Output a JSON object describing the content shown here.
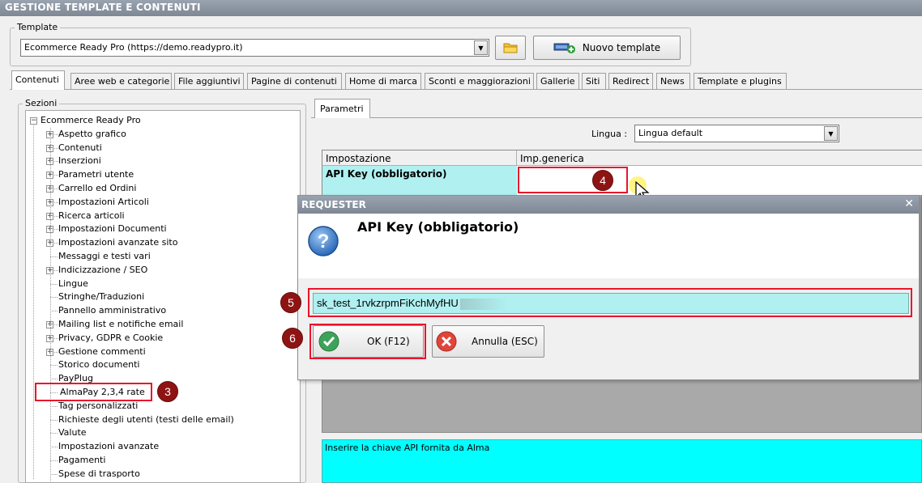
{
  "window": {
    "title": "GESTIONE TEMPLATE E CONTENUTI"
  },
  "template_group": {
    "label": "Template",
    "selected": "Ecommerce Ready Pro (https://demo.readypro.it)",
    "new_button": "Nuovo template"
  },
  "tabs": [
    "Contenuti",
    "Aree web e categorie",
    "File aggiuntivi",
    "Pagine di contenuti",
    "Home di marca",
    "Sconti e maggiorazioni",
    "Gallerie",
    "Siti",
    "Redirect",
    "News",
    "Template e plugins"
  ],
  "tree": {
    "group_label": "Sezioni",
    "root": "Ecommerce Ready Pro",
    "items": [
      {
        "label": "Aspetto grafico",
        "expandable": true
      },
      {
        "label": "Contenuti",
        "expandable": true
      },
      {
        "label": "Inserzioni",
        "expandable": true
      },
      {
        "label": "Parametri utente",
        "expandable": true
      },
      {
        "label": "Carrello ed Ordini",
        "expandable": true
      },
      {
        "label": "Impostazioni Articoli",
        "expandable": true
      },
      {
        "label": "Ricerca articoli",
        "expandable": true
      },
      {
        "label": "Impostazioni Documenti",
        "expandable": true
      },
      {
        "label": "Impostazioni avanzate sito",
        "expandable": true
      },
      {
        "label": "Messaggi e testi vari",
        "expandable": false
      },
      {
        "label": "Indicizzazione / SEO",
        "expandable": true
      },
      {
        "label": "Lingue",
        "expandable": false
      },
      {
        "label": "Stringhe/Traduzioni",
        "expandable": false
      },
      {
        "label": "Pannello amministrativo",
        "expandable": false
      },
      {
        "label": "Mailing list e notifiche email",
        "expandable": true
      },
      {
        "label": "Privacy, GDPR e Cookie",
        "expandable": true
      },
      {
        "label": "Gestione commenti",
        "expandable": true
      },
      {
        "label": "Storico documenti",
        "expandable": false
      },
      {
        "label": "PayPlug",
        "expandable": false
      },
      {
        "label": "AlmaPay 2,3,4 rate",
        "expandable": false,
        "selected": true
      },
      {
        "label": "Tag personalizzati",
        "expandable": false
      },
      {
        "label": "Richieste degli utenti (testi delle email)",
        "expandable": false
      },
      {
        "label": "Valute",
        "expandable": false
      },
      {
        "label": "Impostazioni avanzate",
        "expandable": false
      },
      {
        "label": "Pagamenti",
        "expandable": false
      },
      {
        "label": "Spese di trasporto",
        "expandable": false
      }
    ]
  },
  "params": {
    "tab": "Parametri",
    "language_label": "Lingua :",
    "language_value": "Lingua default",
    "col_setting": "Impostazione",
    "col_generic": "Imp.generica",
    "row_setting": "API Key (obbligatorio)",
    "row_value": "",
    "help_text": "Inserire la chiave API fornita da Alma"
  },
  "dialog": {
    "title": "REQUESTER",
    "heading": "API Key (obbligatorio)",
    "input_value": "sk_test_1rvkzrpmFiKchMyfHU",
    "ok_label": "OK (F12)",
    "cancel_label": "Annulla (ESC)"
  },
  "badges": {
    "b3": "3",
    "b4": "4",
    "b5": "5",
    "b6": "6"
  },
  "colors": {
    "title_bar": "#8a929e",
    "highlight_cyan": "#b0f0f0",
    "help_cyan": "#00ffff",
    "marker_red": "#e8152b",
    "badge_red": "#8e1414"
  },
  "icons": {
    "folder": "folder-icon",
    "new_template": "new-template-icon",
    "question": "question-icon",
    "ok": "check-icon",
    "cancel": "cancel-icon",
    "cursor": "mouse-cursor-icon",
    "close": "close-icon"
  }
}
